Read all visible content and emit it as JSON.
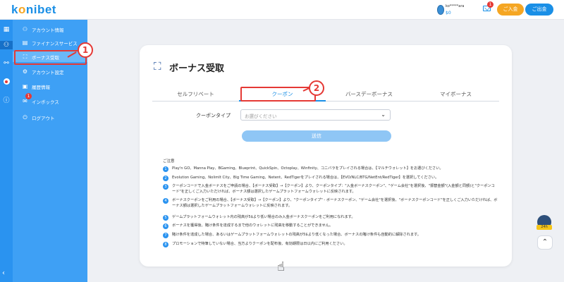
{
  "header": {
    "logo": {
      "before": "k",
      "o": "o",
      "after": "nibet"
    },
    "user": {
      "name": "ko*****ara",
      "balance": "$0"
    },
    "mail_badge": "1",
    "deposit_label": "ご入金",
    "withdraw_label": "ご出金"
  },
  "rail_icons": [
    "grid-icon",
    "user-icon",
    "share-icon",
    "flag-icon",
    "info-icon"
  ],
  "sidebar": {
    "items": [
      {
        "label": "アカウント情報",
        "icon": "user-icon"
      },
      {
        "label": "ファイナンスサービス",
        "icon": "finance-icon"
      },
      {
        "label": "ボーナス受取",
        "icon": "gift-icon"
      },
      {
        "label": "アカウント設定",
        "icon": "gear-icon"
      },
      {
        "label": "履歴情報",
        "icon": "history-icon"
      },
      {
        "label": "インボックス",
        "icon": "inbox-icon",
        "badge": "1"
      },
      {
        "label": "ログアウト",
        "icon": "logout-icon"
      }
    ]
  },
  "page": {
    "title": "ボーナス受取",
    "tabs": [
      "セルフリベート",
      "クーポン",
      "バースデーボーナス",
      "マイボーナス"
    ],
    "active_tab": 1,
    "coupon_type_label": "クーポンタイプ",
    "coupon_select_placeholder": "お選びください",
    "submit_label": "送信",
    "notes_heading": "ご注意",
    "notes": [
      {
        "n": "1",
        "text": "Play'n GO、Manna Play、BGaming、Blueprint、QuickSpin、Octoplay、Winfinity、コニバラをプレイされる場合は、【マルチウォレット】をお選びください。"
      },
      {
        "n": "2",
        "text": "Evolution Gaming、NolimIt City、Big Time Gaming、Netent、RedTigerをプレイされる場合は、【EVO/NLC/BTG/NetEnt/RedTiger】を選択してください。"
      },
      {
        "n": "3",
        "text": "クーポンコードで入金ボーナスをご申請の場合、【ボーナス受取】→【クーポン】より、クーポンタイプ：\"入金ボーナスクーポン\"、\"ゲーム会社\"を選択後、\"振替金額\"(入金額と同額)と\"クーポンコード\"を正しくご入力いただければ、ボーナス額は選択したゲームプラットフォームウォレットに反映されます。"
      },
      {
        "n": "4",
        "text": "ボーナスクーポンをご利用の場合、【ボーナス受取】→【クーポン】より、\"クーポンタイプ\" - ボーナスクーポン、\"ゲーム会社\"を選択後、\"ボーナスクーポンコード\"を正しくご入力いただければ、ボーナス額は選択したゲームプラットフォームウォレットに反映されます。"
      },
      {
        "n": "5",
        "text": "ゲームプラットフォームウォレット内の残高が5$より低い場合のみ入金ボーナスクーポンをご利用になれます。"
      },
      {
        "n": "6",
        "text": "ボーナスを獲得後、賭け条件を達成するまで他のウォレットに残高を移動することができません。"
      },
      {
        "n": "7",
        "text": "賭け条件を達成した場合、あるいはゲームプラットフォームウォレットの残高が5$より低くなった場合、ボーナスの賭け条件も自動的に解除されます。"
      },
      {
        "n": "8",
        "text": "プロモーションで特筆していない場合、当方よりクーポンを配布後、有効期限は日以内にご利用ください。"
      }
    ]
  },
  "annotations": [
    "1",
    "2"
  ],
  "widgets": {
    "mascot_label": "24h",
    "scroll_top": "⌃"
  },
  "colors": {
    "primary": "#1a8fe6",
    "sidebar": "#3ea0f5",
    "accent_orange": "#f5a623",
    "annotation_red": "#e53935"
  }
}
